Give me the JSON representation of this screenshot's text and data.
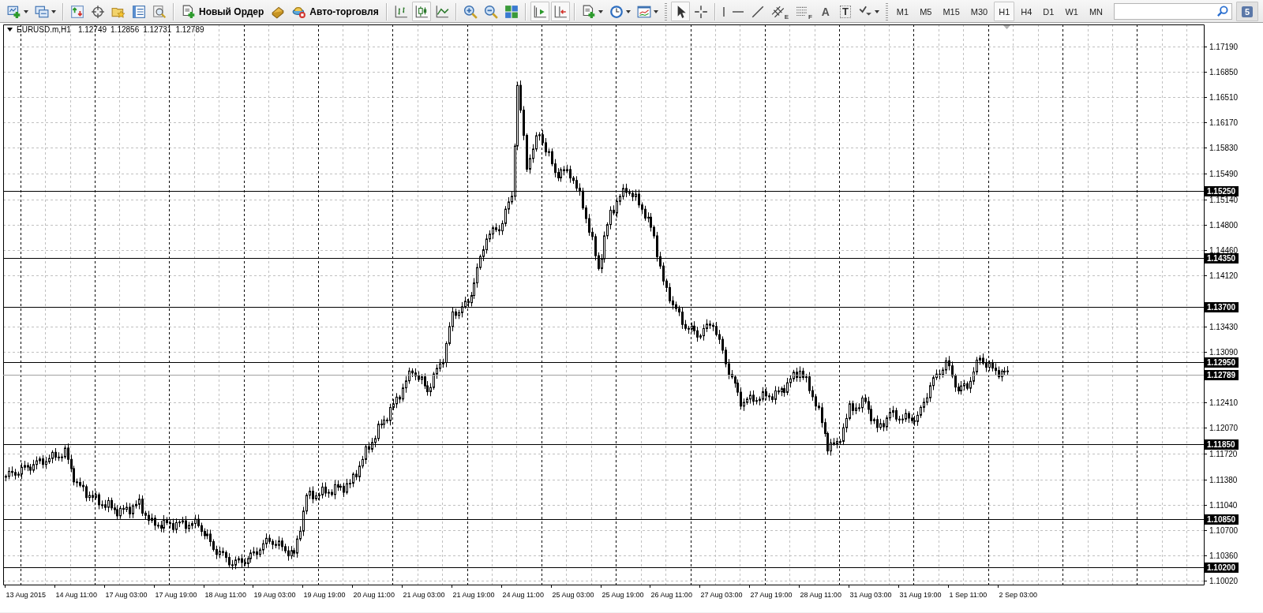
{
  "toolbar": {
    "items": [
      {
        "kind": "menu",
        "pressed": false
      },
      {
        "kind": "menu",
        "pressed": false
      },
      {
        "kind": "separator"
      },
      {
        "kind": "icon",
        "pressed": false
      },
      {
        "kind": "icon",
        "pressed": false
      },
      {
        "kind": "icon",
        "pressed": false
      },
      {
        "kind": "icon",
        "pressed": false
      },
      {
        "kind": "icon",
        "pressed": false
      },
      {
        "kind": "separator"
      },
      {
        "kind": "text-button",
        "label": "Новый Ордер"
      },
      {
        "kind": "icon",
        "pressed": false
      },
      {
        "kind": "text-button",
        "label": "Авто-торговля"
      },
      {
        "kind": "separator"
      },
      {
        "kind": "icon",
        "pressed": false
      },
      {
        "kind": "icon",
        "pressed": true
      },
      {
        "kind": "icon",
        "pressed": false
      },
      {
        "kind": "separator"
      },
      {
        "kind": "icon",
        "pressed": false
      },
      {
        "kind": "icon",
        "pressed": false
      },
      {
        "kind": "icon",
        "pressed": false
      },
      {
        "kind": "separator"
      },
      {
        "kind": "icon",
        "pressed": true
      },
      {
        "kind": "icon",
        "pressed": true
      },
      {
        "kind": "separator"
      },
      {
        "kind": "menu",
        "pressed": false
      },
      {
        "kind": "menu",
        "pressed": false
      },
      {
        "kind": "menu",
        "pressed": false
      },
      {
        "kind": "grip"
      },
      {
        "kind": "icon",
        "pressed": true
      },
      {
        "kind": "icon",
        "pressed": false
      },
      {
        "kind": "separator"
      },
      {
        "kind": "icon",
        "pressed": false
      },
      {
        "kind": "icon",
        "pressed": false
      },
      {
        "kind": "icon",
        "pressed": false
      },
      {
        "kind": "icon",
        "pressed": false,
        "sublabel": "E"
      },
      {
        "kind": "icon",
        "pressed": false,
        "sublabel": "F"
      },
      {
        "kind": "letter",
        "label": "A"
      },
      {
        "kind": "letter-box",
        "label": "T"
      },
      {
        "kind": "menu",
        "pressed": false
      },
      {
        "kind": "grip"
      }
    ],
    "timeframes": [
      {
        "label": "M1",
        "selected": false
      },
      {
        "label": "M5",
        "selected": false
      },
      {
        "label": "M15",
        "selected": false
      },
      {
        "label": "M30",
        "selected": false
      },
      {
        "label": "H1",
        "selected": true
      },
      {
        "label": "H4",
        "selected": false
      },
      {
        "label": "D1",
        "selected": false
      },
      {
        "label": "W1",
        "selected": false
      },
      {
        "label": "MN",
        "selected": false
      }
    ],
    "badge": "5"
  },
  "chart": {
    "header": {
      "symbol": "EURUSD.m,H1",
      "quotes": [
        "1.12749",
        "1.12856",
        "1.12731",
        "1.12789"
      ]
    },
    "price_levels": [
      {
        "label": "1.15250",
        "kind": "level"
      },
      {
        "label": "1.14350",
        "kind": "level"
      },
      {
        "label": "1.13700",
        "kind": "level"
      },
      {
        "label": "1.12950",
        "kind": "level"
      },
      {
        "label": "1.12789",
        "kind": "bid"
      },
      {
        "label": "1.11850",
        "kind": "level"
      },
      {
        "label": "1.10850",
        "kind": "level"
      },
      {
        "label": "1.10200",
        "kind": "level"
      }
    ],
    "price_axis": [
      "1.17190",
      "1.16850",
      "1.16510",
      "1.16170",
      "1.15830",
      "1.15490",
      "1.15140",
      "1.14800",
      "1.14460",
      "1.14120",
      "1.13430",
      "1.13090",
      "1.12410",
      "1.12070",
      "1.11720",
      "1.11380",
      "1.11040",
      "1.10700",
      "1.10360",
      "1.10020"
    ],
    "time_axis": [
      "13 Aug 2015",
      "14 Aug 11:00",
      "17 Aug 03:00",
      "17 Aug 19:00",
      "18 Aug 11:00",
      "19 Aug 03:00",
      "19 Aug 19:00",
      "20 Aug 11:00",
      "21 Aug 03:00",
      "21 Aug 19:00",
      "24 Aug 11:00",
      "25 Aug 03:00",
      "25 Aug 19:00",
      "26 Aug 11:00",
      "27 Aug 03:00",
      "27 Aug 19:00",
      "28 Aug 11:00",
      "31 Aug 03:00",
      "31 Aug 19:00",
      "1 Sep 11:00",
      "2 Sep 03:00"
    ]
  }
}
